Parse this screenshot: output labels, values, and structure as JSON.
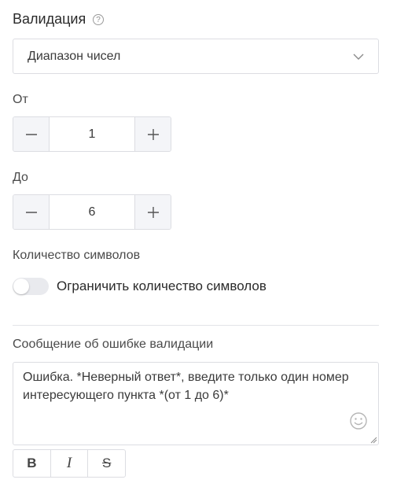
{
  "validation": {
    "title": "Валидация",
    "help_icon": "question-circle-icon",
    "select": {
      "value": "Диапазон чисел",
      "icon": "chevron-down-icon"
    }
  },
  "from": {
    "label": "От",
    "value": "1",
    "decrement_icon": "minus-icon",
    "increment_icon": "plus-icon"
  },
  "to": {
    "label": "До",
    "value": "6",
    "decrement_icon": "minus-icon",
    "increment_icon": "plus-icon"
  },
  "char_count": {
    "label": "Количество символов",
    "toggle_label": "Ограничить количество символов",
    "toggle_on": false
  },
  "error_message": {
    "label": "Сообщение об ошибке валидации",
    "text": "Ошибка. *Неверный ответ*, введите только один номер интересующего пункта *(от 1 до 6)*",
    "emoji_icon": "smiley-icon"
  },
  "format_toolbar": {
    "bold": "B",
    "italic": "I",
    "strike": "S"
  }
}
